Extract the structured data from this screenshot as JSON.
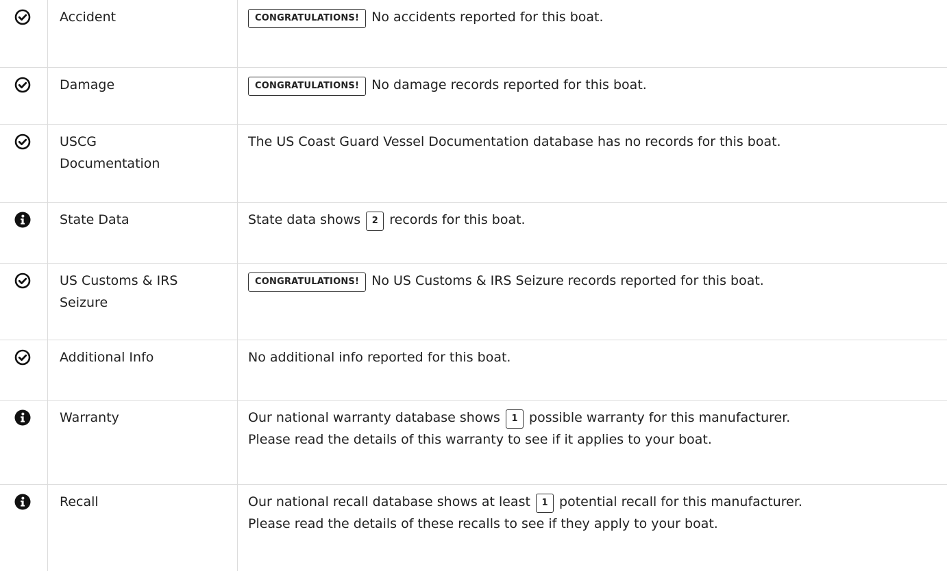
{
  "rows": [
    {
      "icon": "check-circle-icon",
      "category": "Accident",
      "badge": "CONGRATULATIONS!",
      "text": "No accidents reported for this boat."
    },
    {
      "icon": "check-circle-icon",
      "category": "Damage",
      "badge": "CONGRATULATIONS!",
      "text": "No damage records reported for this boat."
    },
    {
      "icon": "check-circle-icon",
      "category": "USCG Documentation",
      "text": "The US Coast Guard Vessel Documentation database has no records for this boat."
    },
    {
      "icon": "info-circle-icon",
      "category": "State Data",
      "text_before": "State data shows",
      "count": "2",
      "text_after": "records for this boat."
    },
    {
      "icon": "check-circle-icon",
      "category": "US Customs & IRS Seizure",
      "badge": "CONGRATULATIONS!",
      "text": "No US Customs & IRS Seizure records reported for this boat."
    },
    {
      "icon": "check-circle-icon",
      "category": "Additional Info",
      "text": "No additional info reported for this boat."
    },
    {
      "icon": "info-circle-icon",
      "category": "Warranty",
      "text_before": "Our national warranty database shows",
      "count": "1",
      "text_after": "possible warranty for this manufacturer.",
      "line2": "Please read the details of this warranty to see if it applies to your boat."
    },
    {
      "icon": "info-circle-icon",
      "category": "Recall",
      "text_before": "Our national recall database shows at least",
      "count": "1",
      "text_after": "potential recall for this manufacturer.",
      "line2": "Please read the details of these recalls to see if they apply to your boat."
    }
  ]
}
